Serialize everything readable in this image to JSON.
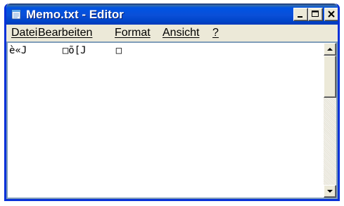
{
  "window": {
    "title": "Memo.txt - Editor",
    "icon": "notepad-icon",
    "buttons": {
      "minimize_icon": "minimize-icon",
      "maximize_icon": "maximize-icon",
      "close_icon": "close-icon"
    }
  },
  "menu": {
    "items": [
      {
        "label": "Datei"
      },
      {
        "label": "Bearbeiten"
      },
      {
        "label": "Format"
      },
      {
        "label": "Ansicht"
      },
      {
        "label": "?"
      }
    ]
  },
  "editor": {
    "content": "è«J      □õ[J     □"
  },
  "scrollbar": {
    "up_icon": "scroll-up-arrow-icon",
    "down_icon": "scroll-down-arrow-icon"
  },
  "colors": {
    "titlebar": "#0054e3",
    "frame": "#0831d9",
    "face": "#ece9d8",
    "editor_border": "#7f9db9"
  }
}
